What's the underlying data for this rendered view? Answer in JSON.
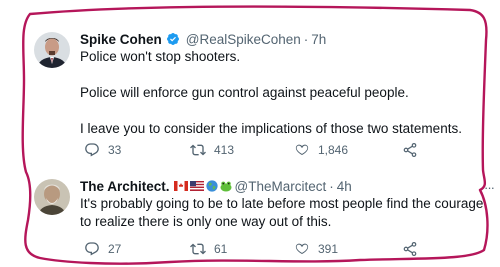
{
  "tweets": [
    {
      "author": "Spike Cohen",
      "handle": "@RealSpikeCohen",
      "separator": "·",
      "time": "7h",
      "verified": true,
      "lines": [
        "Police won't stop shooters.",
        "Police will enforce gun control against peaceful people.",
        "I leave you to consider the implications of those two statements."
      ],
      "replies": "33",
      "retweets": "413",
      "likes": "1,846"
    },
    {
      "author": "The Architect.",
      "handle": "@TheMarcitect",
      "separator": "·",
      "time": "4h",
      "verified": false,
      "lines": [
        "It's probably going to be to late before most people find the courage to realize there is only one way out of this."
      ],
      "replies": "27",
      "retweets": "61",
      "likes": "391"
    }
  ],
  "colors": {
    "verified_blue": "#1d9bf0",
    "secondary_text": "#536471",
    "marker_ink": "#b5165a"
  },
  "icons": {
    "reply": "reply-icon",
    "retweet": "retweet-icon",
    "like": "heart-icon",
    "share": "share-icon",
    "more": "more-icon"
  }
}
